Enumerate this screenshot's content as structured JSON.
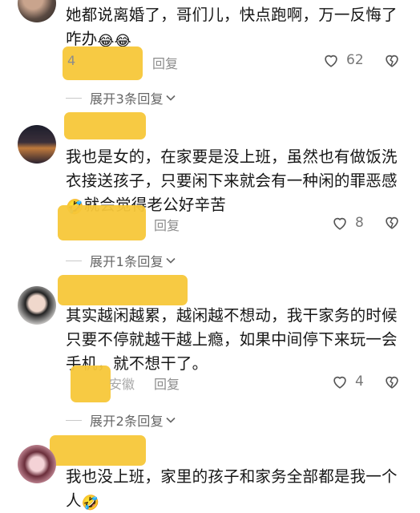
{
  "comments": [
    {
      "text": "她都说离婚了，哥们儿，快点跑啊，万一反悔了咋办",
      "emojis": [
        "😂",
        "😂"
      ],
      "time_partial": "4",
      "reply_label": "回复",
      "like_count": "62",
      "expand_label": "展开3条回复"
    },
    {
      "text": "我也是女的，在家要是没上班，虽然也有做饭洗衣接送孩子，只要闲下来就会有一种闲的罪恶感",
      "emoji": "🤣",
      "text_after": "就会觉得老公好辛苦",
      "reply_label": "回复",
      "like_count": "8",
      "expand_label": "展开1条回复"
    },
    {
      "text": "其实越闲越累，越闲越不想动，我干家务的时候只要不停就越干越上瘾，如果中间停下来玩一会手机，就不想干了。",
      "location_partial": "安徽",
      "reply_label": "回复",
      "like_count": "4",
      "expand_label": "展开2条回复"
    },
    {
      "text": "我也没上班，家里的孩子和家务全部都是我一个人",
      "emoji": "🤣"
    }
  ],
  "icons": {
    "like": "heart-outline-icon",
    "dislike": "broken-heart-icon",
    "chevron": "chevron-down-icon"
  },
  "colors": {
    "censor": "#f7c739",
    "muted": "#8c8c8c"
  }
}
